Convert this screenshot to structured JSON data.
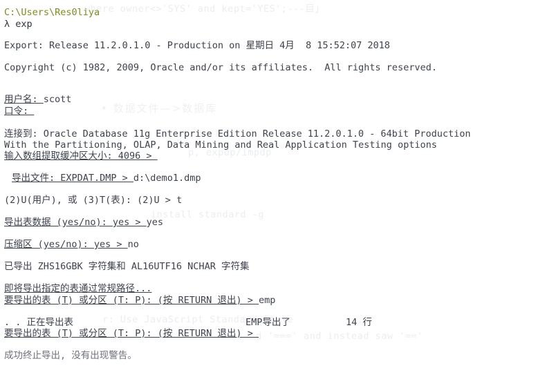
{
  "window": {
    "kind": "console-terminal",
    "background_color": "#ffffff",
    "text_color": "#3d424d",
    "path_color": "#7f8b1e",
    "dim_color": "#6d717a",
    "watermark_color": "#ebedf0"
  },
  "prompt": {
    "path": "C:\\Users\\Res0liya",
    "symbol": "λ",
    "command": "exp"
  },
  "output": {
    "banner_release": "Export: Release 11.2.0.1.0 - Production on 星期日 4月  8 15:52:07 2018",
    "copyright": "Copyright (c) 1982, 2009, Oracle and/or its affiliates.  All rights reserved.",
    "username_prompt": "用户名: ",
    "username_value": "scott",
    "password_prompt": "口令: ",
    "connected_line1": "连接到: Oracle Database 11g Enterprise Edition Release 11.2.0.1.0 - 64bit Production",
    "connected_line2": "With the Partitioning, OLAP, Data Mining and Real Application Testing options",
    "buffer_prompt": "输入数组提取缓冲区大小: 4096 > ",
    "export_file_prompt": "导出文件: EXPDAT.DMP > ",
    "export_file_value": "d:\\demo1.dmp",
    "mode_prompt": "(2)U(用户), 或 (3)T(表): (2)U > ",
    "mode_value": "t",
    "table_data_prompt": "导出表数据 (yes/no): yes > ",
    "table_data_value": "yes",
    "compress_prompt": "压缩区 (yes/no): yes > ",
    "compress_value": "no",
    "charset_line": "已导出 ZHS16GBK 字符集和 AL16UTF16 NCHAR 字符集",
    "about_to_export": "即将导出指定的表通过常规路径...",
    "table_prompt_1": "要导出的表 (T) 或分区 (T: P): (按 RETURN 退出) > ",
    "table_prompt_1_value": "emp",
    "exporting_table": ". . 正在导出表",
    "exported_table_name": "EMP",
    "exported_suffix": "导出了",
    "exported_rows": "14",
    "exported_rows_unit": "行",
    "table_prompt_2": "要导出的表 (T) 或分区 (T: P): (按 RETURN 退出) > ",
    "final_status": "成功终止导出, 没有出现警告。"
  },
  "watermarks": {
    "w1": "where owner<>'SYS' and kept='YES';---目」",
    "w2": "• 数据文件—>数据库",
    "w3": "p, expdp/impdp",
    "w4": "install standard -g",
    "w5": "r: Use JavaScript Standard Style",
    "w6": "d '===' and instead saw '=='"
  }
}
